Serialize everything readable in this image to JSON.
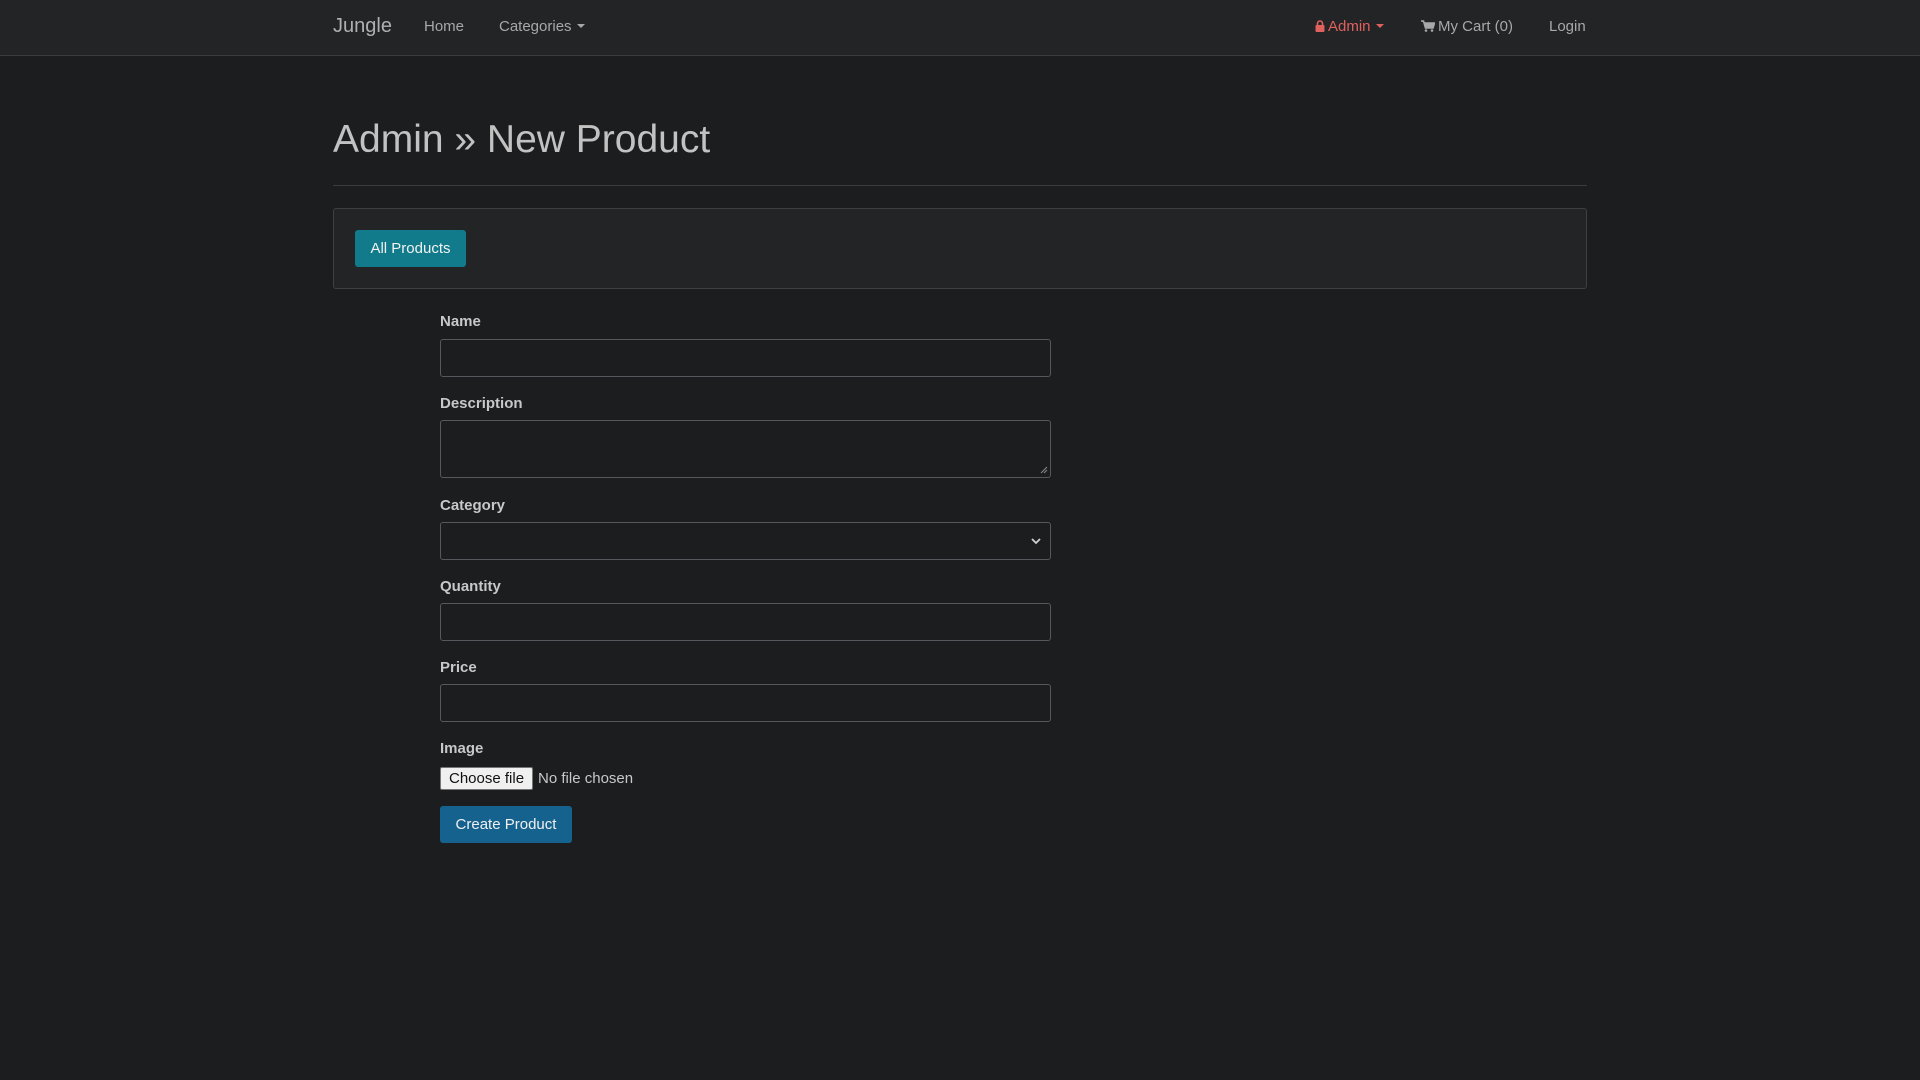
{
  "navbar": {
    "brand": "Jungle",
    "home": "Home",
    "categories": "Categories",
    "admin": "Admin",
    "cart": "My Cart (0)",
    "login": "Login"
  },
  "page": {
    "title": "Admin » New Product"
  },
  "toolbar": {
    "all_products": "All Products"
  },
  "form": {
    "name_label": "Name",
    "name_value": "",
    "description_label": "Description",
    "description_value": "",
    "category_label": "Category",
    "category_selected": "",
    "quantity_label": "Quantity",
    "quantity_value": "",
    "price_label": "Price",
    "price_value": "",
    "image_label": "Image",
    "choose_file": "Choose file",
    "file_status": "No file chosen",
    "submit": "Create Product"
  },
  "colors": {
    "background": "#1b1d1f",
    "navbar": "#222426",
    "admin_accent": "#e0605e",
    "info_button": "#117a8b",
    "primary_button": "#16628f"
  },
  "icons": {
    "admin": "lock-icon",
    "cart": "shopping-cart-icon",
    "dropdown": "caret-down-icon",
    "select": "chevron-down-icon"
  }
}
